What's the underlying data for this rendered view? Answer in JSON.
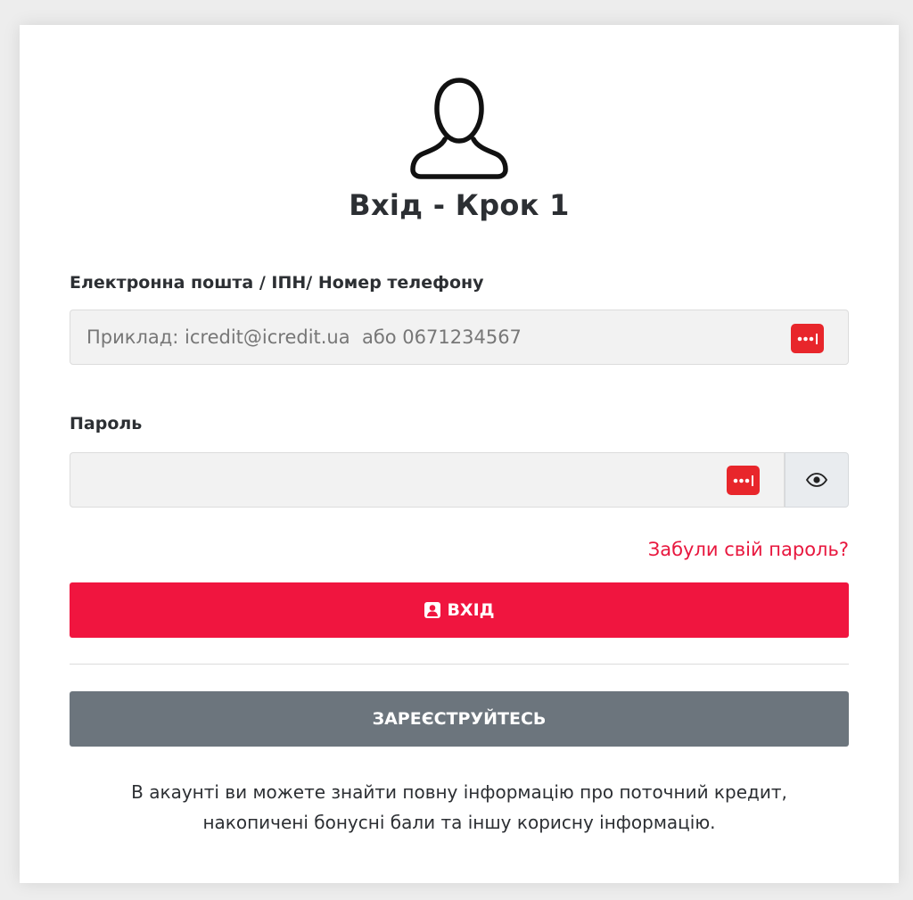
{
  "page": {
    "title": "Вхід - Крок 1"
  },
  "form": {
    "email_label": "Електронна пошта / ІПН/ Номер телефону",
    "email_value": "",
    "email_placeholder": "Приклад: icredit@icredit.ua  або 0671234567",
    "password_label": "Пароль",
    "password_value": "",
    "forgot_link": "Забули свій пароль?"
  },
  "buttons": {
    "login_label": "ВХІД",
    "register_label": "ЗАРЕЄСТРУЙТЕСЬ"
  },
  "info": {
    "line1": "В акаунті ви можете знайти повну інформацію про поточний кредит,",
    "line2": "накопичені бонусні бали та іншу корисну інформацію."
  },
  "icons": {
    "avatar": "user-outline-icon",
    "password_manager": "lastpass-icon",
    "show_password": "eye-icon",
    "login": "user-box-icon"
  },
  "colors": {
    "accent": "#f0153f",
    "link": "#e8173e",
    "secondary_button": "#6c757d",
    "password_manager_badge": "#e8262b"
  }
}
